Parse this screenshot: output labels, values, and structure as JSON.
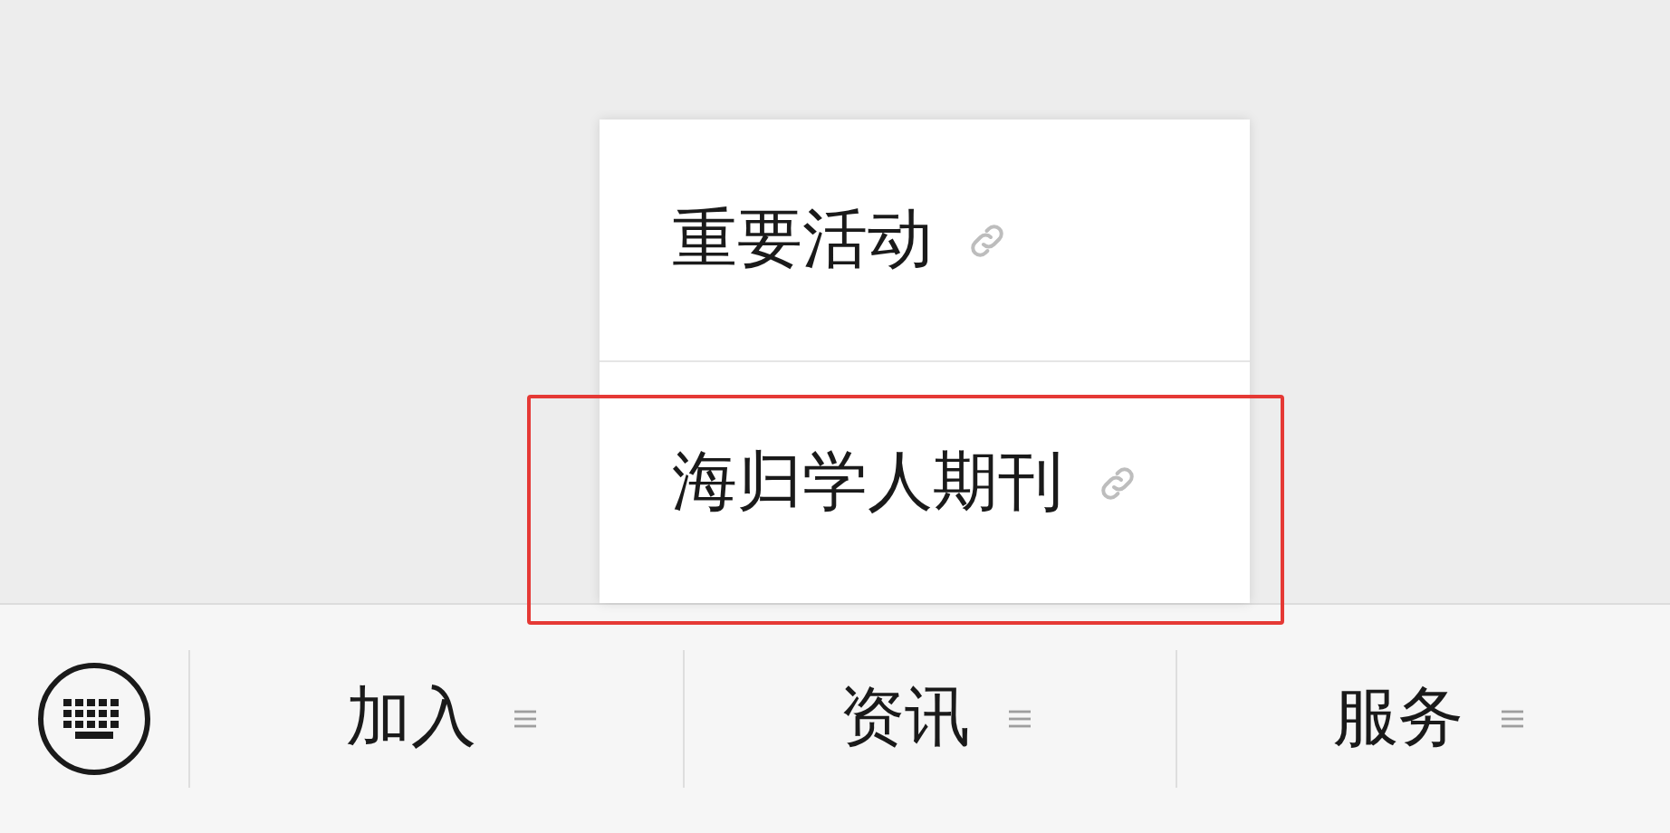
{
  "popup_menu": {
    "items": [
      {
        "label": "重要活动",
        "highlighted": false
      },
      {
        "label": "海归学人期刊",
        "highlighted": true
      }
    ]
  },
  "bottom_menu": {
    "tabs": [
      {
        "label": "加入"
      },
      {
        "label": "资讯"
      },
      {
        "label": "服务"
      }
    ]
  }
}
